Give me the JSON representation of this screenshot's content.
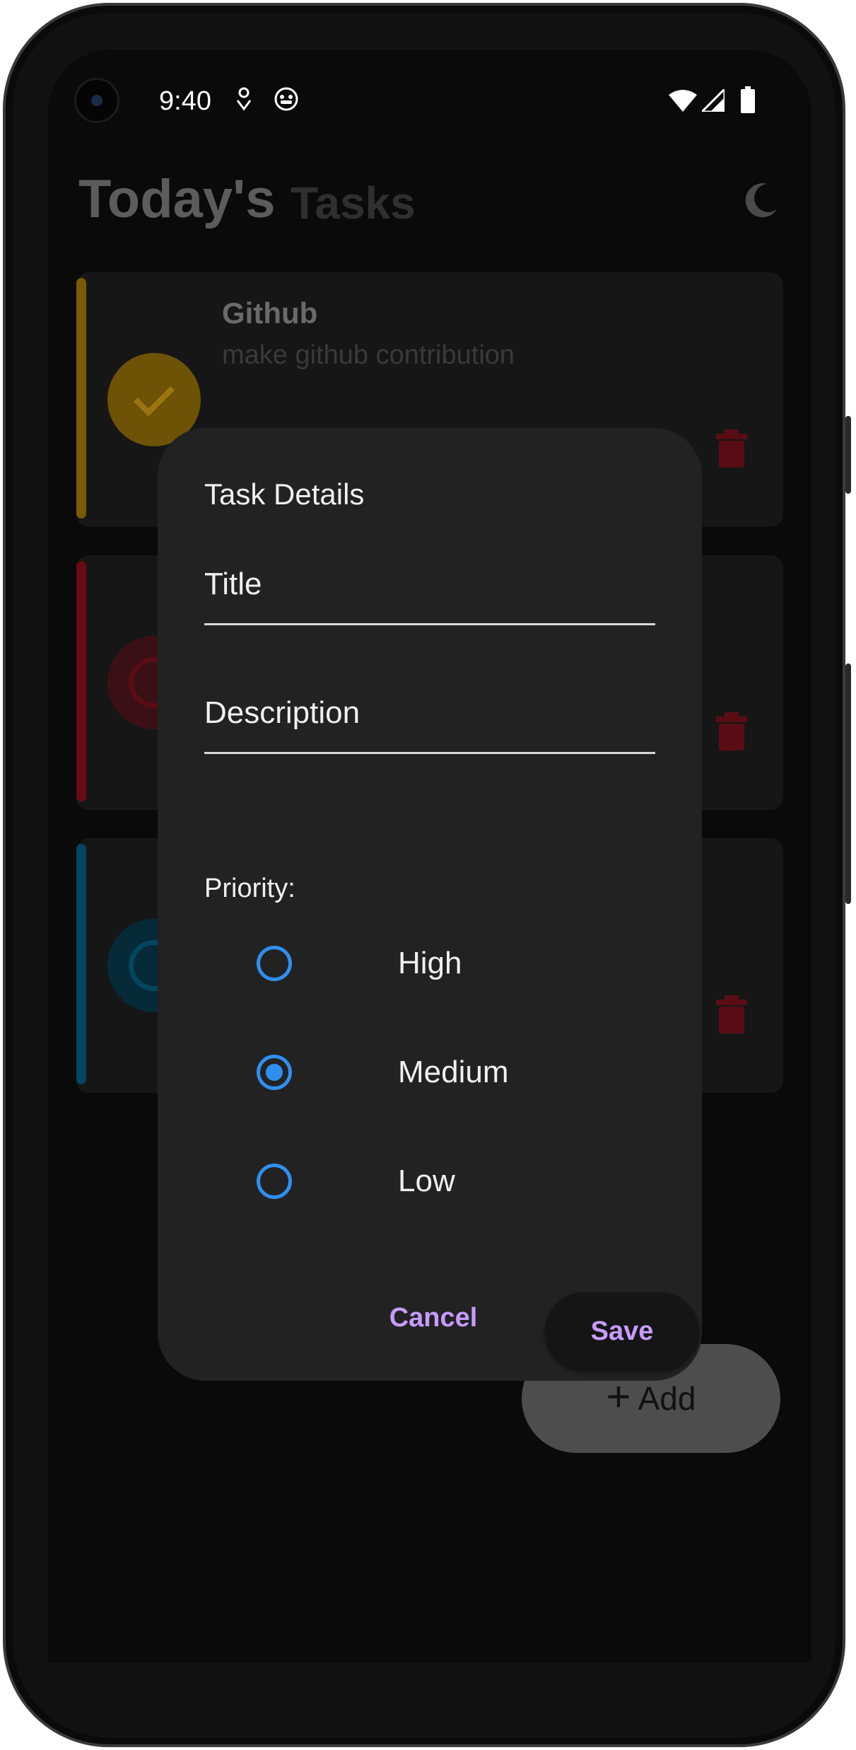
{
  "status_bar": {
    "time": "9:40",
    "icons": [
      "notification-icon",
      "app-icon",
      "wifi-icon",
      "signal-icon",
      "battery-icon"
    ]
  },
  "header": {
    "title_primary": "Today's",
    "title_secondary": "Tasks",
    "theme_toggle_icon": "moon-icon"
  },
  "tasks": [
    {
      "title": "Github",
      "description": "make github contribution",
      "priority_color": "#c8910a",
      "completed": true
    },
    {
      "title": "",
      "description": "",
      "priority_color": "#c01026",
      "completed": false
    },
    {
      "title": "",
      "description": "",
      "priority_color": "#0880b8",
      "completed": false
    }
  ],
  "fab": {
    "label": "Add",
    "icon": "plus-icon"
  },
  "dialog": {
    "title": "Task Details",
    "title_field_placeholder": "Title",
    "description_field_placeholder": "Description",
    "priority_label": "Priority:",
    "options": [
      {
        "label": "High",
        "selected": false
      },
      {
        "label": "Medium",
        "selected": true
      },
      {
        "label": "Low",
        "selected": false
      }
    ],
    "cancel_label": "Cancel",
    "save_label": "Save",
    "accent_color": "#c79bff",
    "radio_color": "#2f8ff0"
  }
}
